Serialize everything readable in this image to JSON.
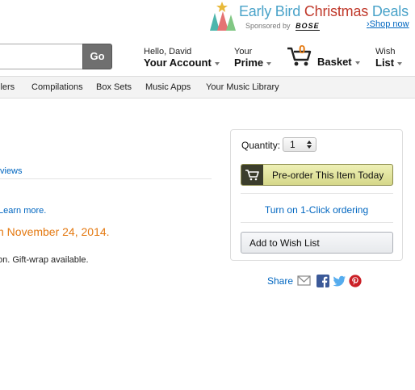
{
  "promo": {
    "word1": "Early Bird",
    "word2": "Christmas",
    "word3": "Deals",
    "sponsored_by": "Sponsored by",
    "brand": "BOSE",
    "shop_now": "Shop now"
  },
  "header": {
    "go_label": "Go",
    "account_small": "Hello, David",
    "account_big": "Your Account",
    "prime_small": "Your",
    "prime_big": "Prime",
    "cart_count": "0",
    "basket_label": "Basket",
    "wish_small": "Wish",
    "wish_big": "List"
  },
  "subnav": {
    "items": [
      "llers",
      "Compilations",
      "Box Sets",
      "Music Apps",
      "Your Music Library"
    ]
  },
  "content": {
    "reviews_link": "views",
    "learn_more": "Learn more.",
    "release_date": "n November 24, 2014.",
    "gift_text": "on. Gift-wrap available."
  },
  "buybox": {
    "quantity_label": "Quantity:",
    "quantity_value": "1",
    "preorder_label": "Pre-order This Item Today",
    "oneclick_label": "Turn on 1-Click ordering",
    "wishlist_label": "Add to Wish List"
  },
  "share": {
    "label": "Share",
    "icons": [
      "email-icon",
      "facebook-icon",
      "twitter-icon",
      "pinterest-icon"
    ]
  },
  "colors": {
    "link": "#0066c0",
    "accent_orange": "#e47911",
    "go_button": "#6f6f6f",
    "preorder_button": "#e0e2a0"
  }
}
